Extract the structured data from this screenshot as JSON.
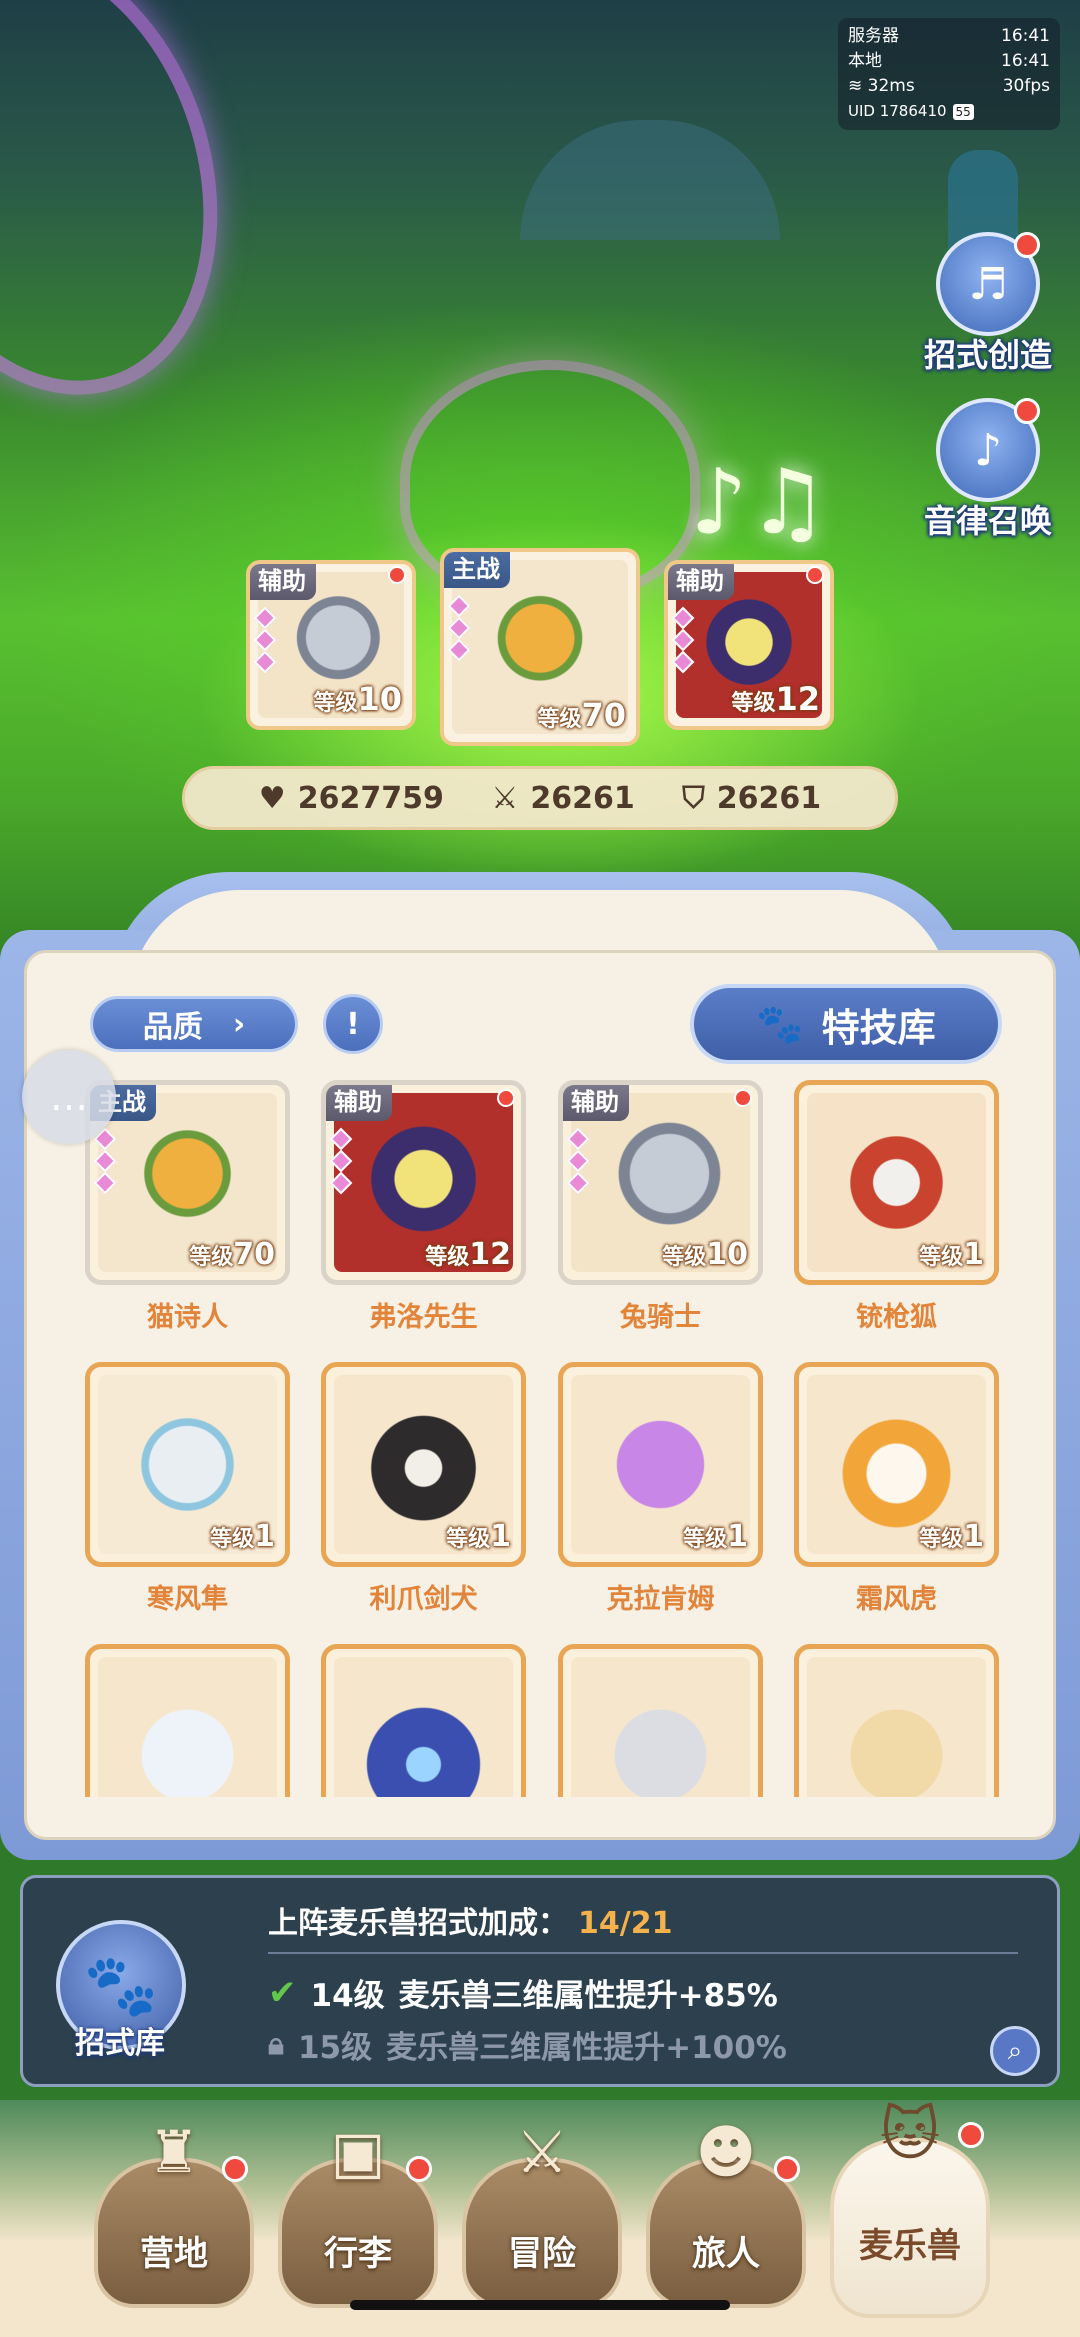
{
  "status": {
    "server_label": "服务器",
    "server_time": "16:41",
    "local_label": "本地",
    "local_time": "16:41",
    "ping": "32ms",
    "fps": "30fps",
    "uid": "UID 1786410",
    "battery": "55"
  },
  "side_buttons": [
    {
      "label": "招式创造",
      "icon": "music-book-icon"
    },
    {
      "label": "音律召唤",
      "icon": "lyre-icon"
    }
  ],
  "lineup": [
    {
      "role": "辅助",
      "level_word": "等级",
      "level": "10",
      "portrait": "knight",
      "red_dot": true
    },
    {
      "role": "主战",
      "level_word": "等级",
      "level": "70",
      "portrait": "cat",
      "red_dot": false
    },
    {
      "role": "辅助",
      "level_word": "等级",
      "level": "12",
      "portrait": "frog",
      "red_dot": true
    }
  ],
  "stats": {
    "hp": "2627759",
    "attack": "26261",
    "defense": "26261"
  },
  "filter": {
    "label": "品质",
    "info_symbol": "!"
  },
  "skill_library_label": "特技库",
  "pets": [
    {
      "name": "猫诗人",
      "role": "主战",
      "level_word": "等级",
      "level": "70",
      "portrait": "cat",
      "red_dot": false
    },
    {
      "name": "弗洛先生",
      "role": "辅助",
      "level_word": "等级",
      "level": "12",
      "portrait": "frog",
      "red_dot": true
    },
    {
      "name": "兔骑士",
      "role": "辅助",
      "level_word": "等级",
      "level": "10",
      "portrait": "knight",
      "red_dot": true
    },
    {
      "name": "铳枪狐",
      "role": "",
      "level_word": "等级",
      "level": "1",
      "portrait": "fox",
      "red_dot": false
    },
    {
      "name": "寒风隼",
      "role": "",
      "level_word": "等级",
      "level": "1",
      "portrait": "white",
      "red_dot": false
    },
    {
      "name": "利爪剑犬",
      "role": "",
      "level_word": "等级",
      "level": "1",
      "portrait": "dog",
      "red_dot": false
    },
    {
      "name": "克拉肯姆",
      "role": "",
      "level_word": "等级",
      "level": "1",
      "portrait": "purple",
      "red_dot": false
    },
    {
      "name": "霜风虎",
      "role": "",
      "level_word": "等级",
      "level": "1",
      "portrait": "tiger",
      "red_dot": false
    },
    {
      "name": "",
      "role": "",
      "level_word": "",
      "level": "",
      "portrait": "ice",
      "red_dot": false
    },
    {
      "name": "",
      "role": "",
      "level_word": "",
      "level": "",
      "portrait": "hood",
      "red_dot": false
    },
    {
      "name": "",
      "role": "",
      "level_word": "",
      "level": "",
      "portrait": "leopard",
      "red_dot": false
    },
    {
      "name": "",
      "role": "",
      "level_word": "",
      "level": "",
      "portrait": "cream",
      "red_dot": false
    }
  ],
  "bonus": {
    "icon_label": "招式库",
    "title": "上阵麦乐兽招式加成：",
    "progress": "14/21",
    "achieved_level": "14级",
    "achieved_text": "麦乐兽三维属性提升+85%",
    "next_level": "15级",
    "next_text": "麦乐兽三维属性提升+100%"
  },
  "nav": [
    {
      "label": "营地",
      "icon": "castle-icon",
      "red_dot": true,
      "active": false
    },
    {
      "label": "行李",
      "icon": "backpack-icon",
      "red_dot": true,
      "active": false
    },
    {
      "label": "冒险",
      "icon": "crossed-swords-icon",
      "red_dot": false,
      "active": false
    },
    {
      "label": "旅人",
      "icon": "traveler-icon",
      "red_dot": true,
      "active": false
    },
    {
      "label": "麦乐兽",
      "icon": "cat-head-icon",
      "red_dot": true,
      "active": true
    }
  ],
  "colors": {
    "accent_blue": "#4c6fbd",
    "name_orange": "#e2843a",
    "progress_gold": "#f5b24a",
    "check_green": "#62c84a",
    "red_dot": "#f04a3e"
  }
}
